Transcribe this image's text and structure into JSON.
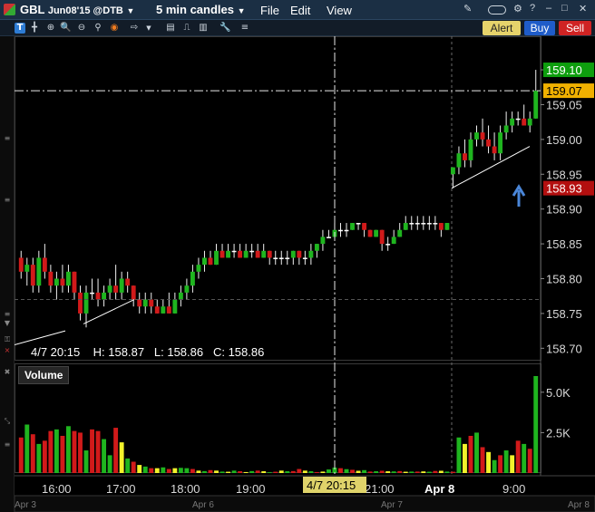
{
  "window": {
    "symbol": "GBL",
    "contract": "Jun08'15 @DTB",
    "interval": "5 min candles",
    "menus": [
      "File",
      "Edit",
      "View"
    ]
  },
  "actions": {
    "alert": "Alert",
    "buy": "Buy",
    "sell": "Sell"
  },
  "toolbar_icons": [
    "text-tool-icon",
    "crosshair-icon",
    "zoom-in-icon",
    "zoom-out-icon",
    "target-icon",
    "arrow-right-icon",
    "grid-icon",
    "line-chart-icon",
    "pencil-icon",
    "wrench-icon",
    "bars-icon"
  ],
  "readout": {
    "date": "4/7 20:15",
    "high": "H: 158.87",
    "low": "L: 158.86",
    "close": "C: 158.86"
  },
  "volume_panel": {
    "label": "Volume",
    "ticks": [
      "5.0K",
      "2.5K"
    ],
    "max": 6000
  },
  "price_labels": {
    "top": "159.10",
    "current": "159.07",
    "low_marker": "158.93"
  },
  "colors": {
    "up": "#1fb51f",
    "down": "#d11a1a",
    "flat": "#f2f22b",
    "alert": "#e6d36b",
    "buy": "#1f5cc9",
    "sell": "#cf2323",
    "current_price": "#f0b000",
    "high_price": "#19c419"
  },
  "crosshair_label": "4/7 20:15",
  "time_labels": [
    "16:00",
    "17:00",
    "18:00",
    "19:00",
    "21:00",
    "Apr 8",
    "9:00"
  ],
  "date_strip": [
    "Apr 3",
    "Apr 6",
    "Apr 7",
    "Apr 8"
  ],
  "chart_data": {
    "type": "candlestick",
    "y_ticks": [
      159.1,
      159.05,
      159.0,
      158.95,
      158.9,
      158.85,
      158.8,
      158.75,
      158.7
    ],
    "ylim": [
      158.69,
      159.13
    ],
    "candles": [
      {
        "o": 158.83,
        "h": 158.84,
        "l": 158.8,
        "c": 158.81
      },
      {
        "o": 158.81,
        "h": 158.83,
        "l": 158.79,
        "c": 158.82
      },
      {
        "o": 158.82,
        "h": 158.83,
        "l": 158.78,
        "c": 158.79
      },
      {
        "o": 158.79,
        "h": 158.84,
        "l": 158.78,
        "c": 158.83
      },
      {
        "o": 158.83,
        "h": 158.85,
        "l": 158.8,
        "c": 158.81
      },
      {
        "o": 158.81,
        "h": 158.82,
        "l": 158.78,
        "c": 158.79
      },
      {
        "o": 158.79,
        "h": 158.81,
        "l": 158.77,
        "c": 158.8
      },
      {
        "o": 158.8,
        "h": 158.82,
        "l": 158.78,
        "c": 158.79
      },
      {
        "o": 158.79,
        "h": 158.82,
        "l": 158.78,
        "c": 158.81
      },
      {
        "o": 158.81,
        "h": 158.81,
        "l": 158.77,
        "c": 158.78
      },
      {
        "o": 158.78,
        "h": 158.79,
        "l": 158.74,
        "c": 158.75
      },
      {
        "o": 158.75,
        "h": 158.79,
        "l": 158.73,
        "c": 158.78
      },
      {
        "o": 158.78,
        "h": 158.8,
        "l": 158.77,
        "c": 158.78
      },
      {
        "o": 158.78,
        "h": 158.8,
        "l": 158.76,
        "c": 158.77
      },
      {
        "o": 158.77,
        "h": 158.79,
        "l": 158.76,
        "c": 158.78
      },
      {
        "o": 158.78,
        "h": 158.8,
        "l": 158.77,
        "c": 158.79
      },
      {
        "o": 158.79,
        "h": 158.82,
        "l": 158.77,
        "c": 158.78
      },
      {
        "o": 158.78,
        "h": 158.81,
        "l": 158.77,
        "c": 158.8
      },
      {
        "o": 158.8,
        "h": 158.81,
        "l": 158.78,
        "c": 158.79
      },
      {
        "o": 158.79,
        "h": 158.79,
        "l": 158.76,
        "c": 158.77
      },
      {
        "o": 158.77,
        "h": 158.78,
        "l": 158.75,
        "c": 158.76
      },
      {
        "o": 158.76,
        "h": 158.78,
        "l": 158.75,
        "c": 158.77
      },
      {
        "o": 158.77,
        "h": 158.78,
        "l": 158.75,
        "c": 158.76
      },
      {
        "o": 158.76,
        "h": 158.77,
        "l": 158.75,
        "c": 158.75
      },
      {
        "o": 158.75,
        "h": 158.77,
        "l": 158.75,
        "c": 158.76
      },
      {
        "o": 158.76,
        "h": 158.78,
        "l": 158.75,
        "c": 158.75
      },
      {
        "o": 158.75,
        "h": 158.78,
        "l": 158.75,
        "c": 158.77
      },
      {
        "o": 158.77,
        "h": 158.79,
        "l": 158.76,
        "c": 158.78
      },
      {
        "o": 158.78,
        "h": 158.8,
        "l": 158.77,
        "c": 158.79
      },
      {
        "o": 158.79,
        "h": 158.82,
        "l": 158.78,
        "c": 158.81
      },
      {
        "o": 158.81,
        "h": 158.83,
        "l": 158.8,
        "c": 158.82
      },
      {
        "o": 158.82,
        "h": 158.84,
        "l": 158.81,
        "c": 158.83
      },
      {
        "o": 158.83,
        "h": 158.84,
        "l": 158.82,
        "c": 158.82
      },
      {
        "o": 158.82,
        "h": 158.85,
        "l": 158.82,
        "c": 158.84
      },
      {
        "o": 158.84,
        "h": 158.85,
        "l": 158.83,
        "c": 158.83
      },
      {
        "o": 158.83,
        "h": 158.85,
        "l": 158.83,
        "c": 158.84
      },
      {
        "o": 158.84,
        "h": 158.85,
        "l": 158.83,
        "c": 158.84
      },
      {
        "o": 158.84,
        "h": 158.85,
        "l": 158.83,
        "c": 158.83
      },
      {
        "o": 158.83,
        "h": 158.85,
        "l": 158.83,
        "c": 158.84
      },
      {
        "o": 158.84,
        "h": 158.85,
        "l": 158.83,
        "c": 158.84
      },
      {
        "o": 158.84,
        "h": 158.85,
        "l": 158.83,
        "c": 158.83
      },
      {
        "o": 158.83,
        "h": 158.85,
        "l": 158.83,
        "c": 158.84
      },
      {
        "o": 158.84,
        "h": 158.84,
        "l": 158.82,
        "c": 158.83
      },
      {
        "o": 158.83,
        "h": 158.84,
        "l": 158.82,
        "c": 158.83
      },
      {
        "o": 158.83,
        "h": 158.84,
        "l": 158.82,
        "c": 158.83
      },
      {
        "o": 158.83,
        "h": 158.84,
        "l": 158.82,
        "c": 158.83
      },
      {
        "o": 158.83,
        "h": 158.84,
        "l": 158.82,
        "c": 158.84
      },
      {
        "o": 158.84,
        "h": 158.84,
        "l": 158.82,
        "c": 158.83
      },
      {
        "o": 158.83,
        "h": 158.84,
        "l": 158.82,
        "c": 158.83
      },
      {
        "o": 158.83,
        "h": 158.85,
        "l": 158.82,
        "c": 158.84
      },
      {
        "o": 158.84,
        "h": 158.85,
        "l": 158.83,
        "c": 158.85
      },
      {
        "o": 158.85,
        "h": 158.87,
        "l": 158.84,
        "c": 158.86
      },
      {
        "o": 158.86,
        "h": 158.87,
        "l": 158.86,
        "c": 158.86
      },
      {
        "o": 158.86,
        "h": 158.88,
        "l": 158.86,
        "c": 158.87
      },
      {
        "o": 158.87,
        "h": 158.88,
        "l": 158.86,
        "c": 158.87
      },
      {
        "o": 158.87,
        "h": 158.88,
        "l": 158.86,
        "c": 158.87
      },
      {
        "o": 158.87,
        "h": 158.88,
        "l": 158.87,
        "c": 158.88
      },
      {
        "o": 158.88,
        "h": 158.88,
        "l": 158.87,
        "c": 158.88
      },
      {
        "o": 158.88,
        "h": 158.88,
        "l": 158.86,
        "c": 158.87
      },
      {
        "o": 158.87,
        "h": 158.87,
        "l": 158.86,
        "c": 158.86
      },
      {
        "o": 158.86,
        "h": 158.87,
        "l": 158.86,
        "c": 158.87
      },
      {
        "o": 158.87,
        "h": 158.87,
        "l": 158.84,
        "c": 158.85
      },
      {
        "o": 158.85,
        "h": 158.86,
        "l": 158.84,
        "c": 158.85
      },
      {
        "o": 158.85,
        "h": 158.87,
        "l": 158.85,
        "c": 158.86
      },
      {
        "o": 158.86,
        "h": 158.88,
        "l": 158.86,
        "c": 158.87
      },
      {
        "o": 158.87,
        "h": 158.89,
        "l": 158.87,
        "c": 158.88
      },
      {
        "o": 158.88,
        "h": 158.89,
        "l": 158.87,
        "c": 158.88
      },
      {
        "o": 158.88,
        "h": 158.89,
        "l": 158.87,
        "c": 158.88
      },
      {
        "o": 158.88,
        "h": 158.89,
        "l": 158.87,
        "c": 158.88
      },
      {
        "o": 158.88,
        "h": 158.89,
        "l": 158.87,
        "c": 158.88
      },
      {
        "o": 158.88,
        "h": 158.89,
        "l": 158.87,
        "c": 158.88
      },
      {
        "o": 158.88,
        "h": 158.88,
        "l": 158.86,
        "c": 158.87
      },
      {
        "o": 158.87,
        "h": 158.88,
        "l": 158.87,
        "c": 158.88
      },
      {
        "o": 158.95,
        "h": 158.96,
        "l": 158.93,
        "c": 158.96
      },
      {
        "o": 158.96,
        "h": 158.99,
        "l": 158.95,
        "c": 158.98
      },
      {
        "o": 158.98,
        "h": 159.0,
        "l": 158.96,
        "c": 158.97
      },
      {
        "o": 158.97,
        "h": 159.01,
        "l": 158.96,
        "c": 159.0
      },
      {
        "o": 159.0,
        "h": 159.02,
        "l": 158.99,
        "c": 159.01
      },
      {
        "o": 159.01,
        "h": 159.03,
        "l": 158.99,
        "c": 159.0
      },
      {
        "o": 159.0,
        "h": 159.02,
        "l": 158.98,
        "c": 158.99
      },
      {
        "o": 158.99,
        "h": 159.01,
        "l": 158.97,
        "c": 158.98
      },
      {
        "o": 158.98,
        "h": 159.02,
        "l": 158.97,
        "c": 159.01
      },
      {
        "o": 159.01,
        "h": 159.04,
        "l": 159.0,
        "c": 159.02
      },
      {
        "o": 159.02,
        "h": 159.04,
        "l": 159.01,
        "c": 159.03
      },
      {
        "o": 159.03,
        "h": 159.04,
        "l": 159.02,
        "c": 159.03
      },
      {
        "o": 159.03,
        "h": 159.05,
        "l": 159.02,
        "c": 159.02
      },
      {
        "o": 159.02,
        "h": 159.04,
        "l": 159.01,
        "c": 159.03
      },
      {
        "o": 159.03,
        "h": 159.1,
        "l": 159.03,
        "c": 159.07
      }
    ],
    "volumes": [
      2200,
      3000,
      2400,
      1800,
      2000,
      2600,
      2700,
      2300,
      2900,
      2600,
      2500,
      1400,
      2700,
      2600,
      2100,
      1100,
      2800,
      1900,
      900,
      700,
      500,
      400,
      300,
      300,
      350,
      250,
      300,
      320,
      300,
      250,
      150,
      120,
      180,
      150,
      90,
      80,
      150,
      110,
      60,
      120,
      150,
      110,
      50,
      80,
      150,
      110,
      120,
      250,
      150,
      110,
      60,
      90,
      220,
      340,
      300,
      240,
      200,
      140,
      180,
      90,
      110,
      140,
      110,
      100,
      120,
      80,
      90,
      90,
      100,
      80,
      130,
      140,
      90,
      80,
      2200,
      1800,
      2300,
      2500,
      1600,
      1300,
      800,
      1100,
      1400,
      1100,
      2000,
      1800,
      1500,
      6000
    ],
    "volume_colors": [
      "down",
      "up",
      "down",
      "up",
      "down",
      "down",
      "up",
      "down",
      "up",
      "down",
      "down",
      "up",
      "down",
      "down",
      "up",
      "up",
      "down",
      "flat",
      "up",
      "down",
      "flat",
      "up",
      "down",
      "flat",
      "up",
      "down",
      "flat",
      "up",
      "up",
      "down",
      "flat",
      "up",
      "down",
      "flat",
      "up",
      "flat",
      "up",
      "down",
      "flat",
      "up",
      "down",
      "flat",
      "up",
      "down",
      "flat",
      "up",
      "down",
      "down",
      "flat",
      "up",
      "down",
      "flat",
      "up",
      "up",
      "down",
      "up",
      "down",
      "flat",
      "up",
      "down",
      "up",
      "down",
      "flat",
      "up",
      "down",
      "flat",
      "up",
      "down",
      "flat",
      "up",
      "down",
      "flat",
      "up",
      "down",
      "up",
      "flat",
      "down",
      "up",
      "down",
      "flat",
      "up",
      "down",
      "up",
      "flat",
      "down",
      "up",
      "down",
      "up"
    ]
  }
}
